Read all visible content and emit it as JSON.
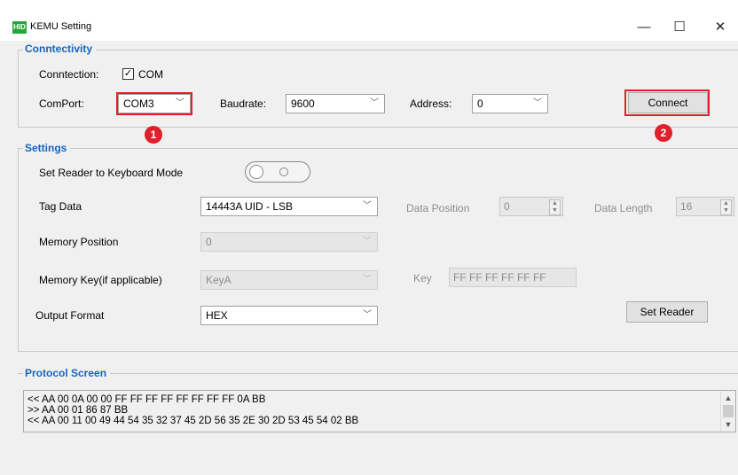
{
  "window": {
    "icon_text": "HID",
    "title": "KEMU Setting",
    "minimize": "—",
    "maximize": "☐",
    "close": "✕"
  },
  "connectivity": {
    "group_title": "Conntectivity",
    "connection_label": "Conntection:",
    "com_checked": true,
    "com_label": "COM",
    "comport_label": "ComPort:",
    "comport_value": "COM3",
    "baudrate_label": "Baudrate:",
    "baudrate_value": "9600",
    "address_label": "Address:",
    "address_value": "0",
    "connect_button": "Connect",
    "badge_1": "1",
    "badge_2": "2"
  },
  "settings": {
    "group_title": "Settings",
    "keyboard_mode_label": "Set Reader to Keyboard Mode",
    "keyboard_mode_on": false,
    "tag_data_label": "Tag Data",
    "tag_data_value": "14443A UID - LSB",
    "data_position_label": "Data Position",
    "data_position_value": "0",
    "data_length_label": "Data Length",
    "data_length_value": "16",
    "memory_position_label": "Memory Position",
    "memory_position_value": "0",
    "memory_key_label": "Memory Key(if applicable)",
    "memory_key_value": "KeyA",
    "key_label": "Key",
    "key_value": "FF FF FF FF FF FF",
    "output_format_label": "Output Format",
    "output_format_value": "HEX",
    "set_reader_button": "Set Reader"
  },
  "protocol": {
    "group_title": "Protocol Screen",
    "lines": [
      "<< AA 00 0A 00 00 FF FF FF FF FF FF FF FF 0A BB",
      ">> AA 00 01 86 87 BB",
      "<< AA 00 11 00 49 44 54 35 32 37 45 2D 56 35 2E 30 2D 53 45 54 02 BB"
    ]
  },
  "colors": {
    "accent_blue": "#1565c0",
    "highlight_red": "#e0202a"
  }
}
